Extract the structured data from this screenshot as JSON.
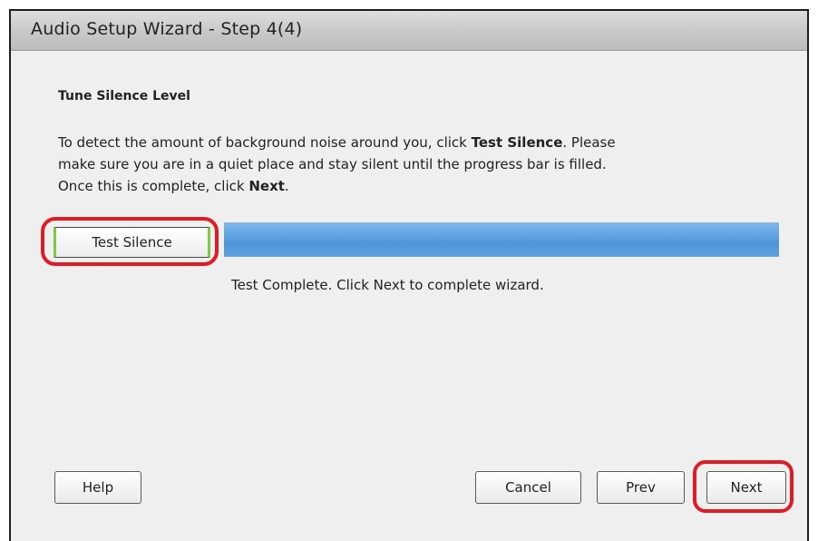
{
  "window": {
    "title": "Audio Setup Wizard - Step 4(4)"
  },
  "step": {
    "heading": "Tune Silence Level",
    "description_lines": [
      [
        "To detect the amount of background noise around you, click ",
        "Test Silence",
        ". Please"
      ],
      [
        "make sure you are in a quiet place and stay silent until the progress bar is filled."
      ],
      [
        "Once this is complete, click ",
        "Next",
        "."
      ]
    ],
    "test_button_label": "Test Silence",
    "progress": 1.0,
    "status": "Test Complete. Click Next to complete wizard."
  },
  "footer": {
    "help_label": "Help",
    "cancel_label": "Cancel",
    "prev_label": "Prev",
    "next_label": "Next"
  },
  "colors": {
    "highlight": "#e01b24",
    "progress_fill": "#5b9fdf",
    "focus_accent": "#7fc64a"
  }
}
